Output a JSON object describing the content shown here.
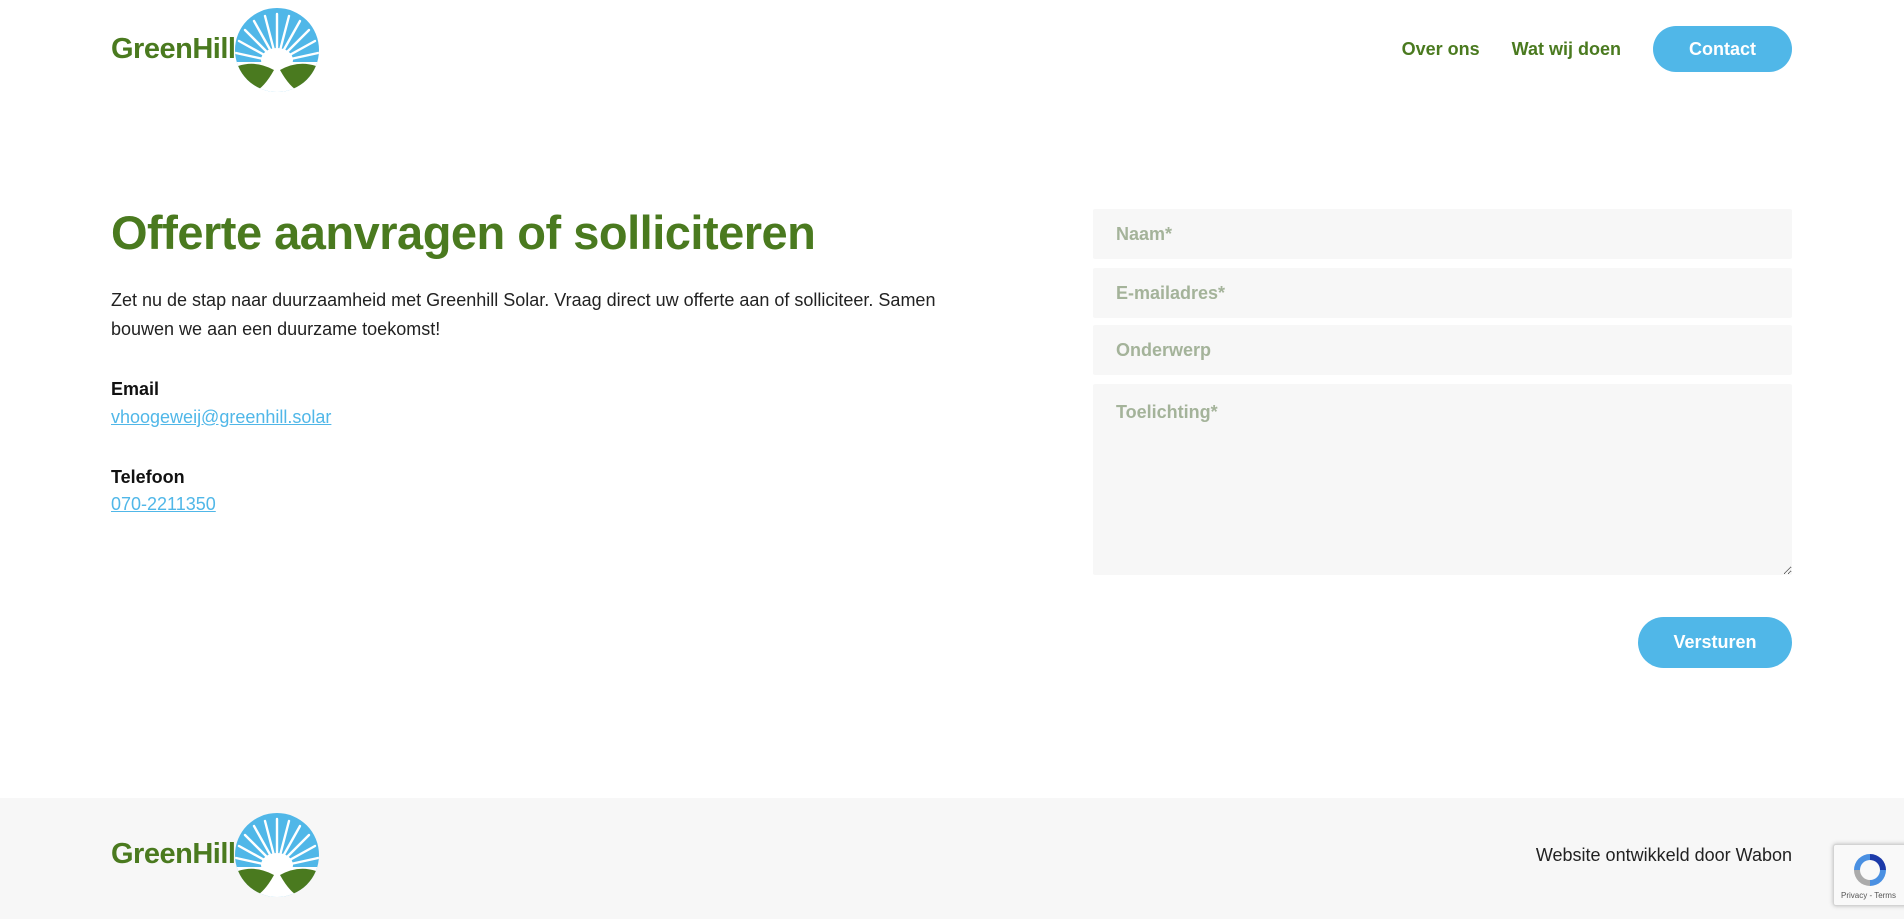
{
  "brand": {
    "name": "GreenHill",
    "primary_color": "#4a7a1f",
    "accent_color": "#50b7e8"
  },
  "nav": {
    "links": [
      "Over ons",
      "Wat wij doen"
    ],
    "cta": "Contact"
  },
  "main": {
    "title": "Offerte aanvragen of solliciteren",
    "intro": "Zet nu de stap naar duurzaamheid met Greenhill Solar. Vraag direct uw offerte aan of solliciteer. Samen bouwen we aan een duurzame toekomst!",
    "email_label": "Email",
    "email_value": "vhoogeweij@greenhill.solar",
    "phone_label": "Telefoon",
    "phone_value": "070-2211350"
  },
  "form": {
    "name_placeholder": "Naam*",
    "email_placeholder": "E-mailadres*",
    "subject_placeholder": "Onderwerp",
    "message_placeholder": "Toelichting*",
    "submit_label": "Versturen"
  },
  "footer": {
    "credit": "Website ontwikkeld door Wabon"
  },
  "recaptcha": {
    "links": "Privacy - Terms",
    "icon": "recaptcha-icon"
  }
}
